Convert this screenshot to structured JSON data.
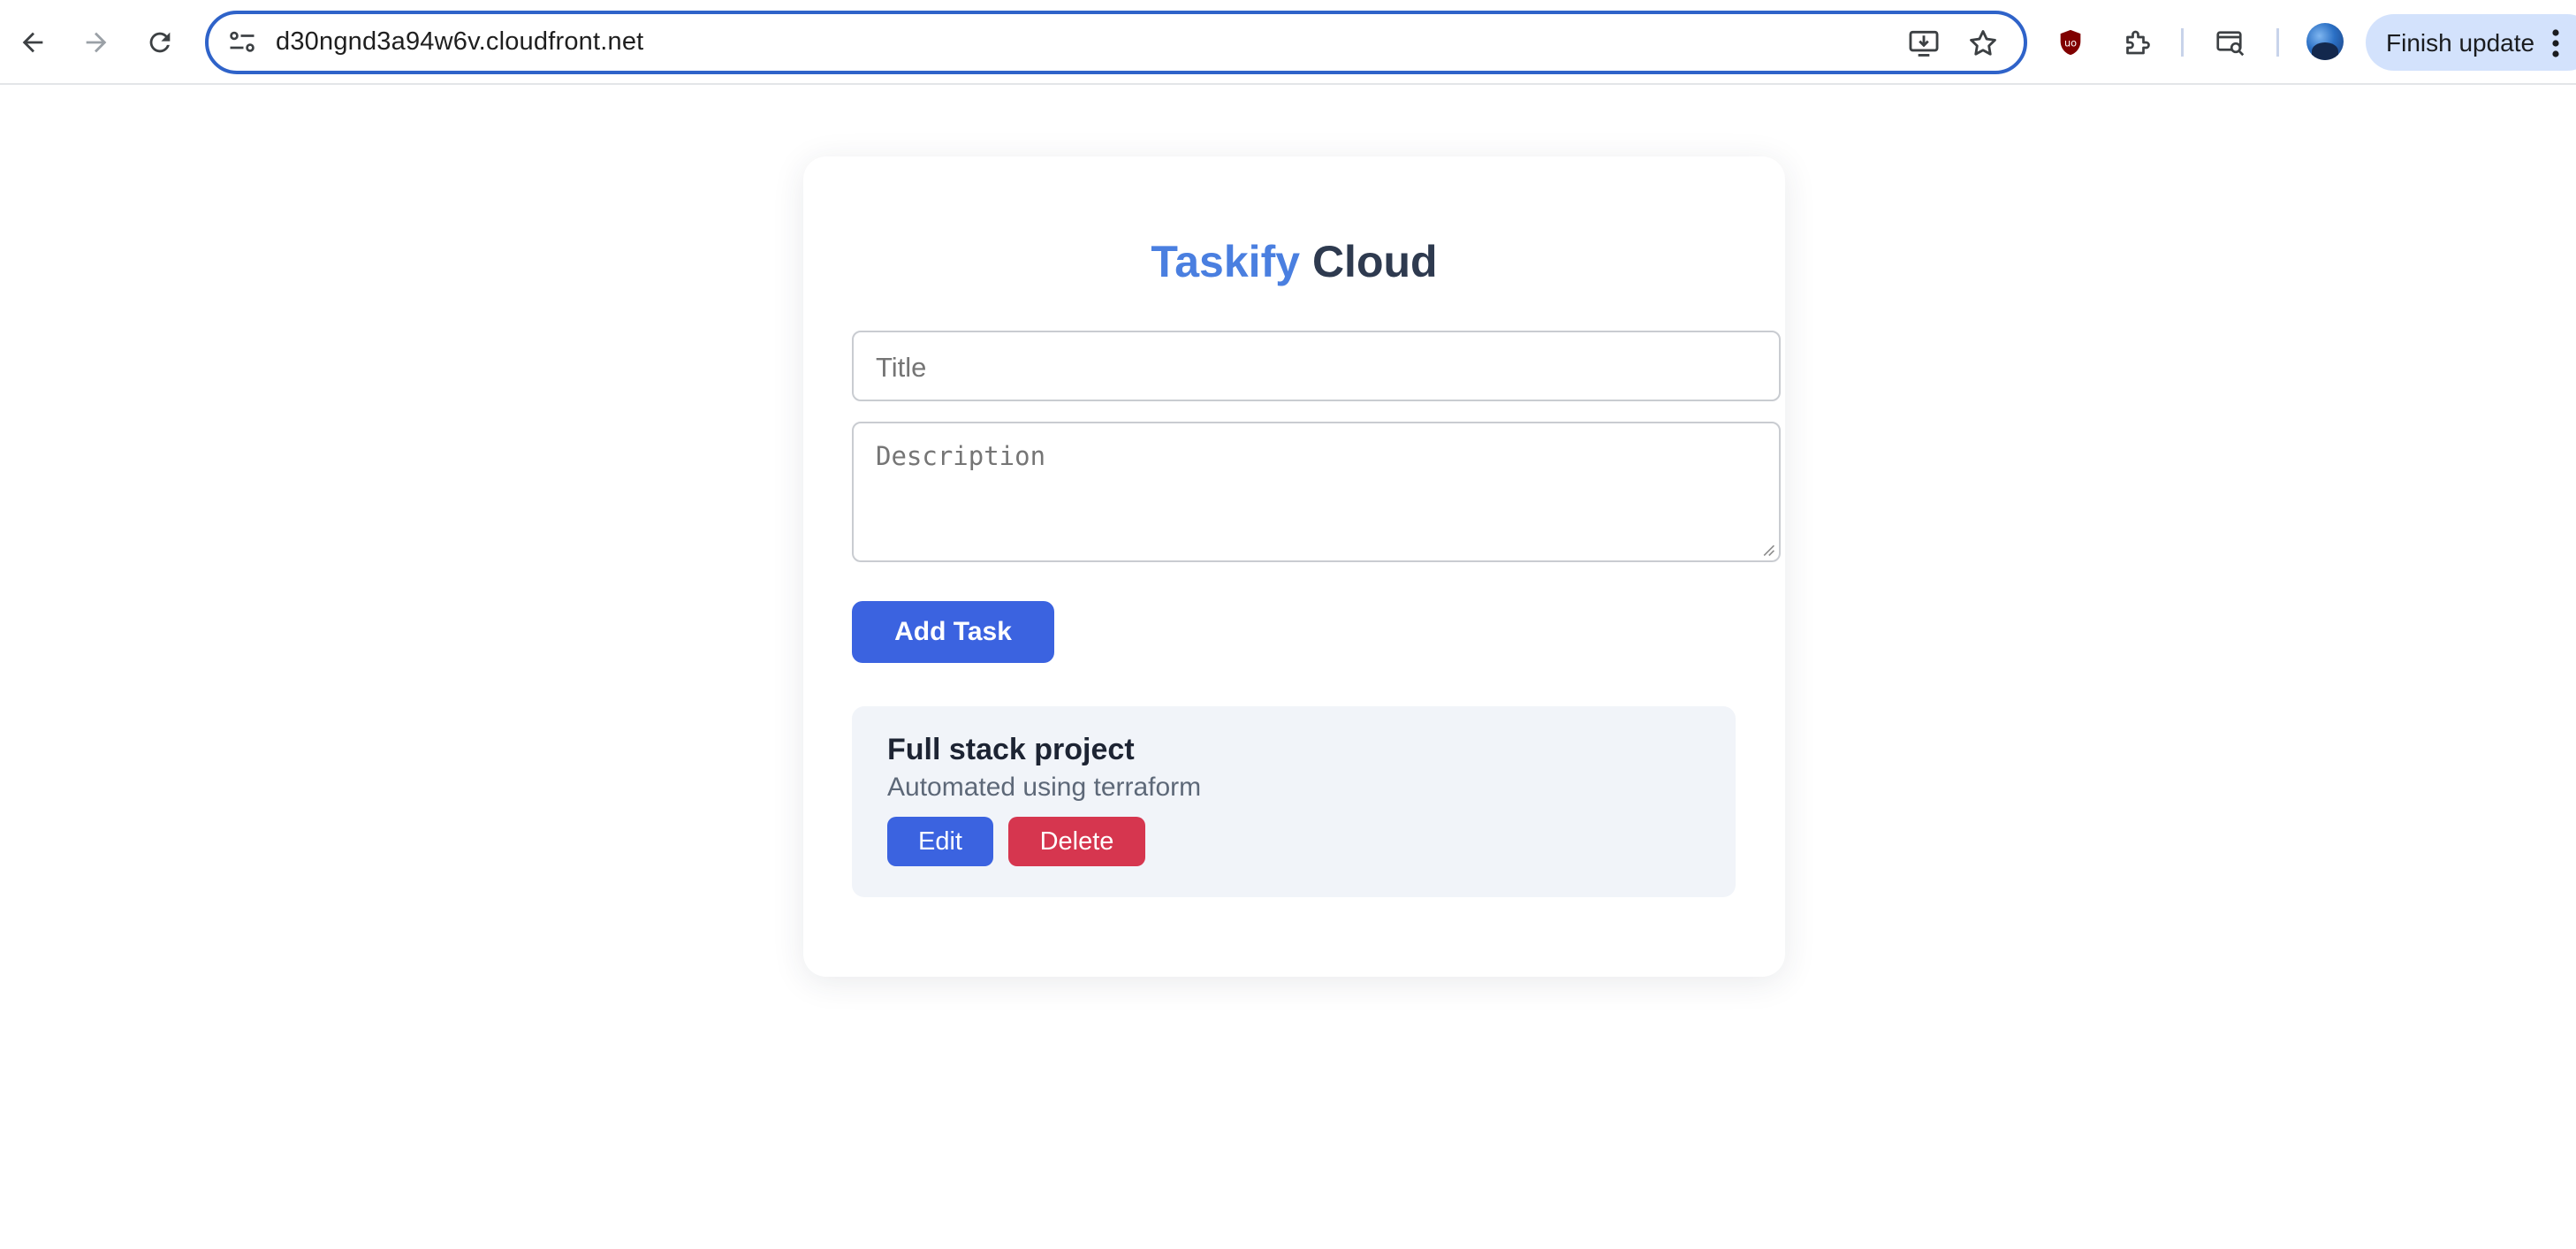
{
  "browser": {
    "url": "d30ngnd3a94w6v.cloudfront.net",
    "update_label": "Finish update",
    "icons": [
      "back-arrow-icon",
      "forward-arrow-icon",
      "reload-icon",
      "site-info-icon",
      "install-app-icon",
      "bookmark-star-icon",
      "ublock-shield-icon",
      "extensions-puzzle-icon",
      "tab-search-icon",
      "profile-avatar",
      "kebab-menu-icon"
    ]
  },
  "app": {
    "title_accent": "Taskify",
    "title_rest": "Cloud",
    "title_placeholder": "Title",
    "description_placeholder": "Description",
    "add_button": "Add Task",
    "tasks": [
      {
        "title": "Full stack project",
        "description": "Automated using terraform",
        "edit_label": "Edit",
        "delete_label": "Delete"
      }
    ]
  },
  "colors": {
    "accent": "#4a7fe0",
    "primary_button": "#3b63e0",
    "danger_button": "#d6364f",
    "task_background": "#f1f4f9",
    "omnibox_border": "#2f63c9"
  }
}
